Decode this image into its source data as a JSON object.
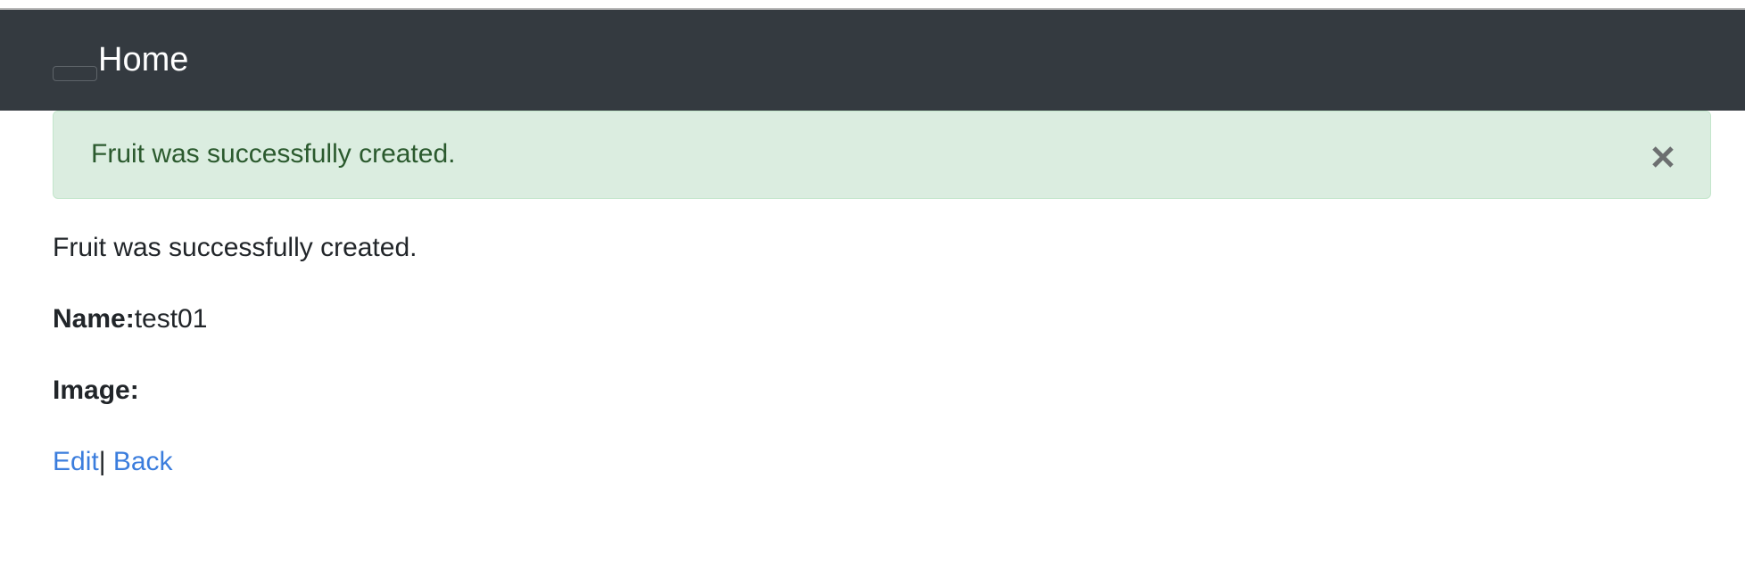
{
  "navbar": {
    "brand": "Home",
    "background": "#343a40"
  },
  "alert": {
    "message": "Fruit was successfully created.",
    "close_icon": "close-icon",
    "background": "#dbede0",
    "text_color": "#2b5a2e"
  },
  "notice": "Fruit was successfully created.",
  "fields": {
    "name_label": "Name:",
    "name_value": "test01",
    "image_label": "Image:"
  },
  "links": {
    "edit": "Edit",
    "separator": "|",
    "back": "Back",
    "color": "#3b7ddd"
  }
}
